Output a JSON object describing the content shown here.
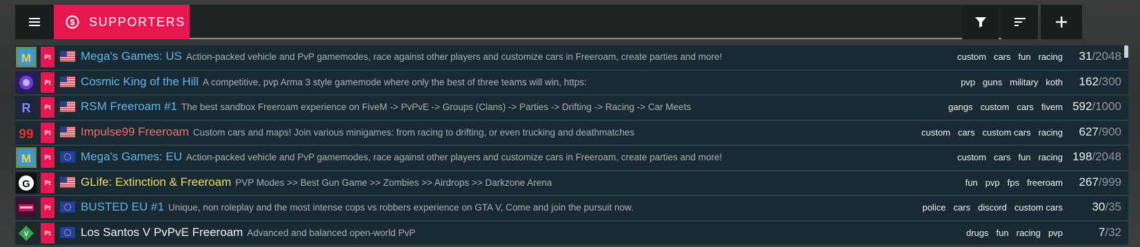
{
  "tab": {
    "label": "SUPPORTERS",
    "color": "#e8174f"
  },
  "search": {
    "value": ""
  },
  "actions": [
    "filter-icon",
    "sort-icon",
    "plus-icon"
  ],
  "badge_text": "Pt",
  "servers": [
    {
      "title": "Mega's Games: US",
      "title_color": "#5fb7ec",
      "flag": "us",
      "icon": "mega",
      "description": "Action-packed vehicle and PvP gamemodes, race against other players and customize cars in Freeroam, create parties and more!",
      "tags": [
        "custom",
        "cars",
        "fun",
        "racing"
      ],
      "players": "31",
      "max": "/2048"
    },
    {
      "title": "Cosmic King of the Hill",
      "title_color": "#5fb7ec",
      "flag": "us",
      "icon": "cosmic",
      "description": "A competitive, pvp Arma 3 style gamemode where only the best of three teams will win, https:",
      "tags": [
        "pvp",
        "guns",
        "military",
        "koth"
      ],
      "players": "162",
      "max": "/300"
    },
    {
      "title": "RSM Freeroam #1",
      "title_color": "#5fb7ec",
      "flag": "us",
      "icon": "rsm",
      "description": "The best sandbox Freeroam experience on FiveM -> PvPvE -> Groups (Clans) -> Parties -> Drifting -> Racing -> Car Meets",
      "tags": [
        "gangs",
        "custom",
        "cars",
        "fivem"
      ],
      "players": "592",
      "max": "/1000"
    },
    {
      "title": "Impulse99 Freeroam",
      "title_color": "#e8736d",
      "flag": "us",
      "icon": "impulse",
      "description": "Custom cars and maps! Join various minigames: from racing to drifting, or even trucking and deathmatches",
      "tags": [
        "custom",
        "cars",
        "custom cars",
        "racing"
      ],
      "players": "627",
      "max": "/900"
    },
    {
      "title": "Mega's Games: EU",
      "title_color": "#5fb7ec",
      "flag": "eu",
      "icon": "mega",
      "description": "Action-packed vehicle and PvP gamemodes, race against other players and customize cars in Freeroam, create parties and more!",
      "tags": [
        "custom",
        "cars",
        "fun",
        "racing"
      ],
      "players": "198",
      "max": "/2048"
    },
    {
      "title": "GLife: Extinction & Freeroam",
      "title_color": "#f0dd6a",
      "flag": "us",
      "icon": "glife",
      "description": "PVP Modes >> Best Gun Game >> Zombies >> Airdrops >> Darkzone Arena",
      "tags": [
        "fun",
        "pvp",
        "fps",
        "freeroam"
      ],
      "players": "267",
      "max": "/999"
    },
    {
      "title": "BUSTED EU #1",
      "title_color": "#5fb7ec",
      "flag": "eu",
      "icon": "busted",
      "description": "Unique, non roleplay and the most intense cops vs robbers experience on GTA V, Come and join the pursuit now.",
      "tags": [
        "police",
        "cars",
        "discord",
        "custom cars"
      ],
      "players": "30",
      "max": "/35"
    },
    {
      "title": "Los Santos V PvPvE Freeroam",
      "title_color": "#f2f4f5",
      "flag": "eu",
      "icon": "lsv",
      "description": "Advanced and balanced open-world PvP",
      "tags": [
        "drugs",
        "fun",
        "racing",
        "pvp"
      ],
      "players": "7",
      "max": "/32"
    }
  ]
}
